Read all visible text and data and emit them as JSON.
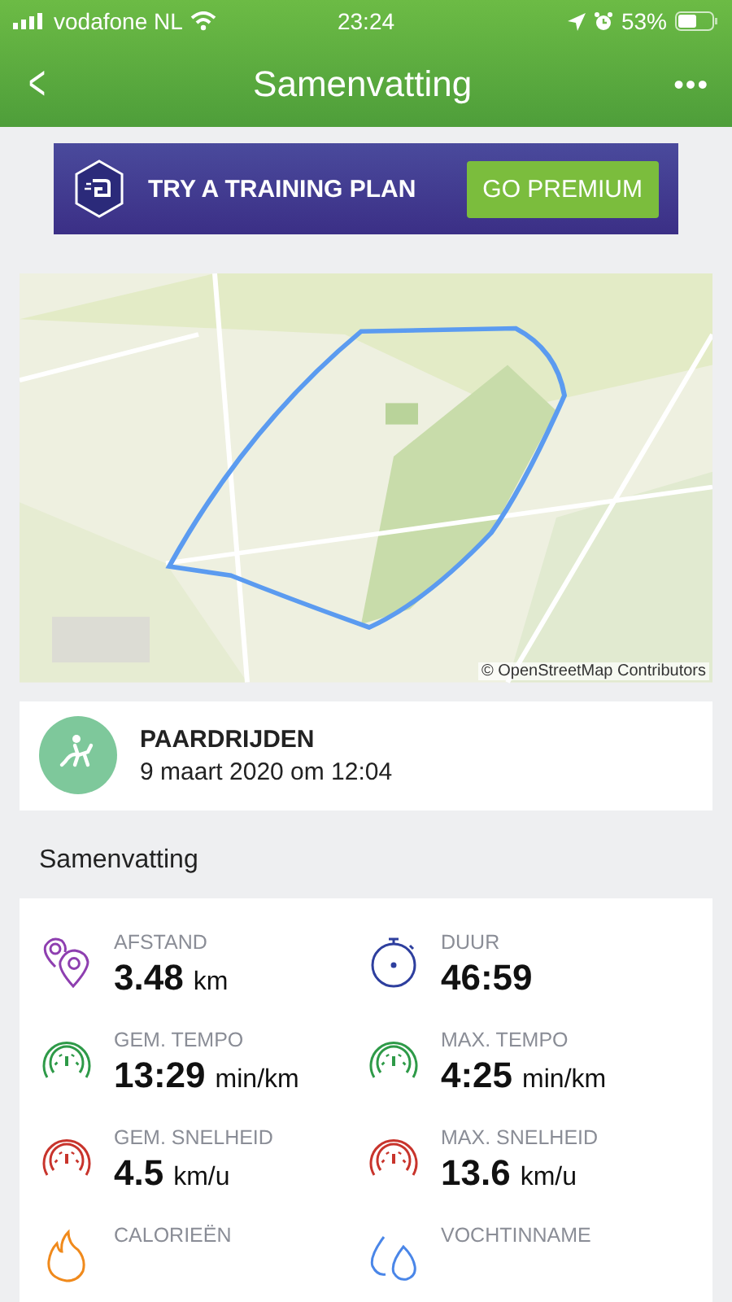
{
  "status_bar": {
    "carrier": "vodafone NL",
    "time": "23:24",
    "battery": "53%"
  },
  "nav": {
    "title": "Samenvatting",
    "back": "<",
    "more": "•••"
  },
  "banner": {
    "text": "TRY A TRAINING PLAN",
    "button": "GO PREMIUM"
  },
  "map": {
    "kind": "picture",
    "attribution": "© OpenStreetMap Contributors"
  },
  "activity": {
    "type": "PAARDRIJDEN",
    "date": "9 maart 2020 om 12:04"
  },
  "section_title": "Samenvatting",
  "stats": [
    {
      "kind": "distance",
      "color": "#8e3fb0",
      "label": "AFSTAND",
      "value": "3.48",
      "unit": "km"
    },
    {
      "kind": "stopwatch",
      "color": "#2e3f9e",
      "label": "DUUR",
      "value": "46:59"
    },
    {
      "kind": "gauge",
      "color": "#2e9a48",
      "label": "GEM. TEMPO",
      "value": "13:29",
      "unit": "min/km"
    },
    {
      "kind": "gauge",
      "color": "#2e9a48",
      "label": "MAX. TEMPO",
      "value": "4:25",
      "unit": "min/km"
    },
    {
      "kind": "gauge",
      "color": "#c8342c",
      "label": "GEM. SNELHEID",
      "value": "4.5",
      "unit": "km/u"
    },
    {
      "kind": "gauge",
      "color": "#c8342c",
      "label": "MAX. SNELHEID",
      "value": "13.6",
      "unit": "km/u"
    },
    {
      "kind": "flame",
      "color": "#f08a1c",
      "label": "CALORIEËN"
    },
    {
      "kind": "drops",
      "color": "#4a86e8",
      "label": "VOCHTINNAME"
    }
  ]
}
